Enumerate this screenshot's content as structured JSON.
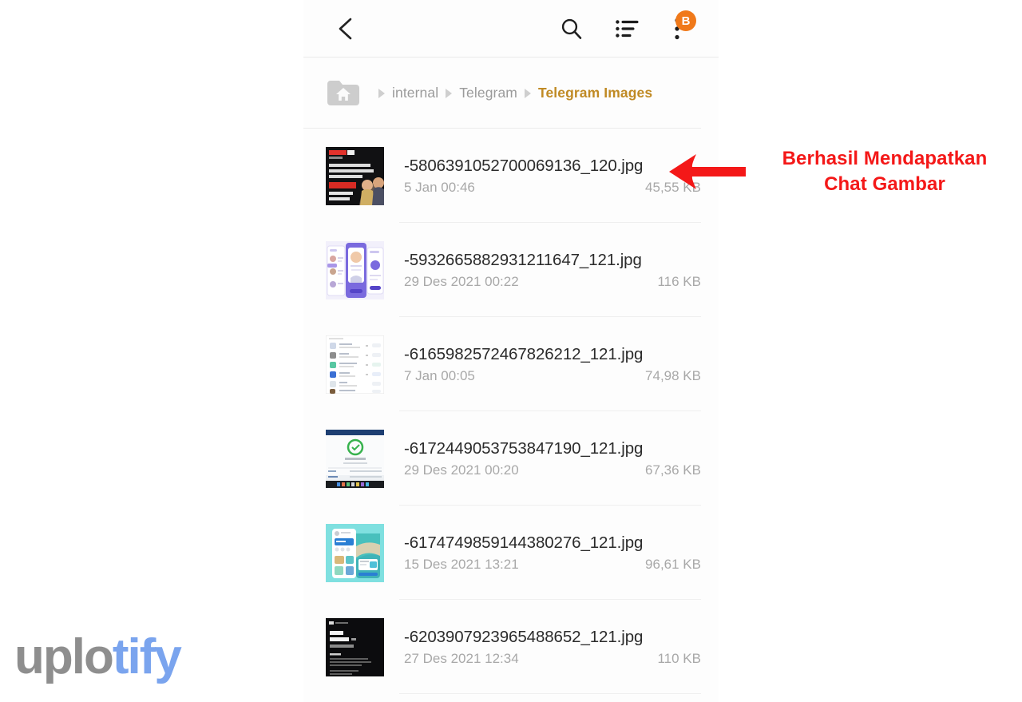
{
  "toolbar": {
    "back_icon": "back-arrow-icon",
    "search_icon": "search-icon",
    "sort_icon": "sort-list-icon",
    "overflow_icon": "overflow-menu-icon",
    "badge_label": "B",
    "badge_color": "#F0791A"
  },
  "breadcrumb": {
    "home_icon": "home-folder-icon",
    "items": [
      {
        "label": "internal",
        "current": false
      },
      {
        "label": "Telegram",
        "current": false
      },
      {
        "label": "Telegram Images",
        "current": true
      }
    ],
    "current_color": "#C08A24"
  },
  "files": [
    {
      "name": "-5806391052700069136_120.jpg",
      "date": "5 Jan 00:46",
      "size": "45,55 KB",
      "thumb": "poster-dark-red"
    },
    {
      "name": "-5932665882931211647_121.jpg",
      "date": "29 Des 2021 00:22",
      "size": "116 KB",
      "thumb": "ui-mockup-purple"
    },
    {
      "name": "-6165982572467826212_121.jpg",
      "date": "7 Jan 00:05",
      "size": "74,98 KB",
      "thumb": "list-screenshot-white"
    },
    {
      "name": "-6172449053753847190_121.jpg",
      "date": "29 Des 2021 00:20",
      "size": "67,36 KB",
      "thumb": "monitor-photo-green"
    },
    {
      "name": "-6174749859144380276_121.jpg",
      "date": "15 Des 2021 13:21",
      "size": "96,61 KB",
      "thumb": "travel-app-cyan"
    },
    {
      "name": "-6203907923965488652_121.jpg",
      "date": "27 Des 2021 12:34",
      "size": "110 KB",
      "thumb": "hiring-poster-black"
    }
  ],
  "annotation": {
    "line1": "Berhasil Mendapatkan",
    "line2": "Chat Gambar",
    "color": "#F41818",
    "arrow_icon": "left-arrow-icon"
  },
  "watermark": {
    "part1": "uplo",
    "part2": "tify",
    "color1": "#8e8e8e",
    "color2": "#7aa4ee"
  }
}
